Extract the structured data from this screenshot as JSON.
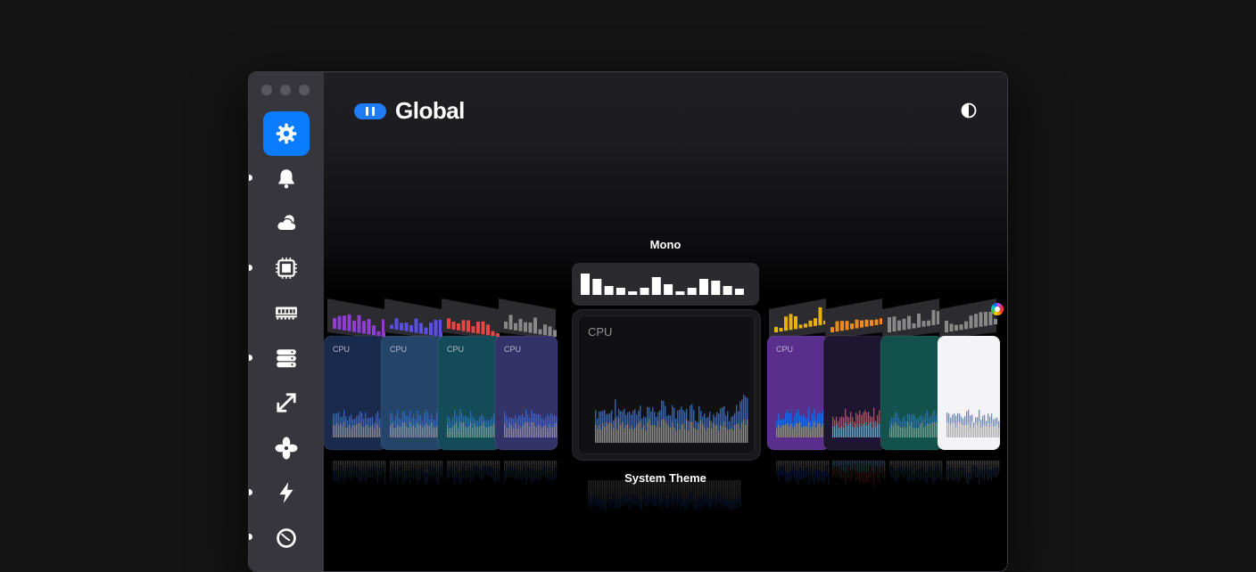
{
  "window": {
    "title": "Global"
  },
  "sidebar": {
    "items": [
      {
        "id": "general",
        "icon": "gear-icon",
        "active": true
      },
      {
        "id": "notifications",
        "icon": "bell-icon",
        "active": false
      },
      {
        "id": "weather",
        "icon": "cloud-sun-icon",
        "active": false
      },
      {
        "id": "cpu",
        "icon": "cpu-chip-icon",
        "active": false
      },
      {
        "id": "memory",
        "icon": "memory-icon",
        "active": false
      },
      {
        "id": "storage",
        "icon": "disk-stack-icon",
        "active": false
      },
      {
        "id": "network",
        "icon": "arrows-transfer-icon",
        "active": false
      },
      {
        "id": "fans",
        "icon": "fan-icon",
        "active": false
      },
      {
        "id": "power",
        "icon": "bolt-icon",
        "active": false
      },
      {
        "id": "clock",
        "icon": "clock-icon",
        "active": false
      }
    ]
  },
  "header": {
    "title": "Global",
    "toggle_icon": "pause-toggle-icon",
    "theme_icon": "contrast-icon"
  },
  "themes": {
    "selected_name": "Mono",
    "appearance_label": "System Theme",
    "card_label": "CPU"
  },
  "colors": {
    "accent": "#0a7cff",
    "sidebar": "#36363c",
    "blue_bars": "#1f66e0",
    "gray_bars": "#8a8a8a"
  }
}
